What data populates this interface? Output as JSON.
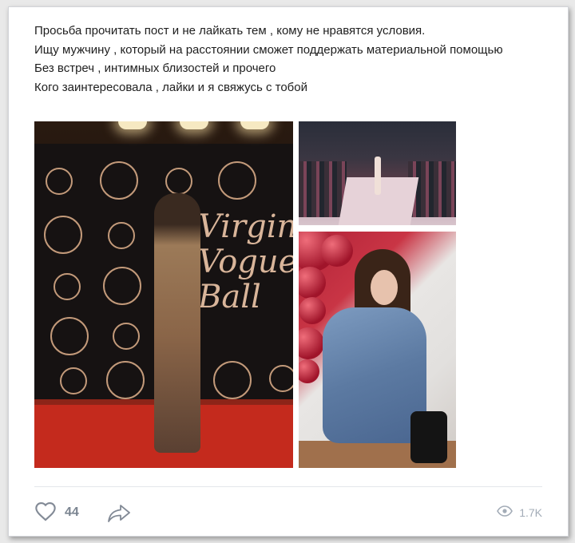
{
  "post": {
    "lines": [
      "Просьба прочитать пост и не лайкать тем , кому не нравятся условия.",
      "Ищу мужчину , который на расстоянии сможет поддержать материальной помощью",
      "Без встреч , интимных близостей и прочего",
      "Кого заинтересовала , лайки и я свяжусь с тобой"
    ],
    "photo_main_logo_text": "Virgin Vogue Ball"
  },
  "footer": {
    "like_icon": "heart-icon",
    "likes": "44",
    "share_icon": "share-arrow-icon",
    "views_icon": "eye-icon",
    "views": "1.7K"
  },
  "colors": {
    "text": "#1e1e1e",
    "counter": "#7b8591",
    "views": "#a3acb7",
    "divider": "#e4e6ea"
  }
}
